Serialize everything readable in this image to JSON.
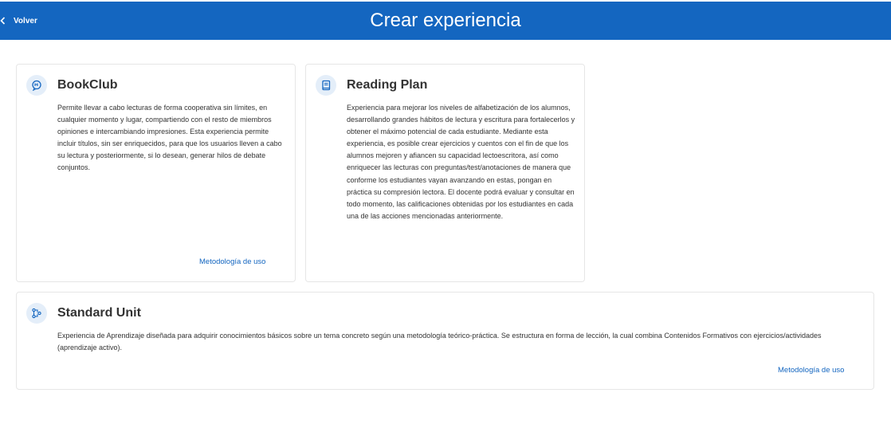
{
  "header": {
    "back_label": "Volver",
    "title": "Crear experiencia",
    "color": "#1466c0"
  },
  "cards": [
    {
      "icon": "chat-bubble-icon",
      "title": "BookClub",
      "description": "Permite llevar a cabo lecturas de forma cooperativa sin límites, en cualquier momento y lugar, compartiendo con el resto de miembros opiniones e intercambiando impresiones. Esta experiencia permite incluir títulos, sin ser enriquecidos, para que los usuarios lleven a cabo su lectura y posteriormente, si lo desean, generar hilos de debate conjuntos.",
      "link": "Metodología de uso"
    },
    {
      "icon": "book-icon",
      "title": "Reading Plan",
      "description": "Experiencia para mejorar los niveles de alfabetización de los alumnos, desarrollando grandes hábitos de lectura y escritura para fortalecerlos y obtener el máximo potencial de cada estudiante. Mediante esta experiencia, es posible crear ejercicios y cuentos con el fin de que los alumnos mejoren y afiancen su capacidad lectoescritora, así como enriquecer las lecturas con preguntas/test/anotaciones de manera que conforme los estudiantes vayan avanzando en estas, pongan en práctica su compresión lectora. El docente podrá evaluar y consultar en todo momento, las calificaciones obtenidas por los estudiantes en cada una de las acciones mencionadas anteriormente.",
      "link": ""
    },
    {
      "icon": "nodes-icon",
      "title": "Standard Unit",
      "description": "Experiencia de Aprendizaje diseñada para adquirir conocimientos básicos sobre un tema concreto según una metodología teórico-práctica. Se estructura en forma de lección, la cual combina Contenidos Formativos con ejercicios/actividades (aprendizaje activo).",
      "link": "Metodología de uso"
    }
  ]
}
